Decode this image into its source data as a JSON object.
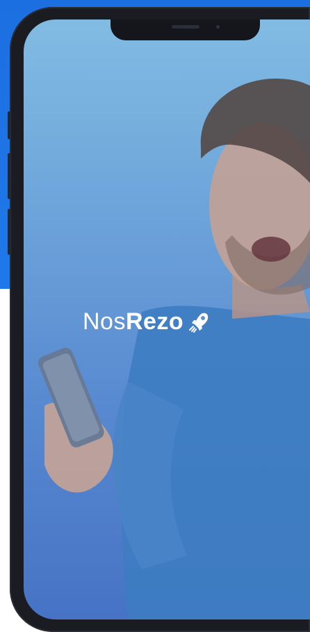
{
  "app": {
    "logo_part1": "Nos",
    "logo_part2": "Rezo"
  },
  "colors": {
    "background_blue": "#1f78ea",
    "screen_top": "#8dc7e6",
    "screen_bottom": "#4a74c4",
    "phone_frame": "#1a1c22"
  },
  "icons": {
    "logo_mark": "rocket-icon"
  }
}
